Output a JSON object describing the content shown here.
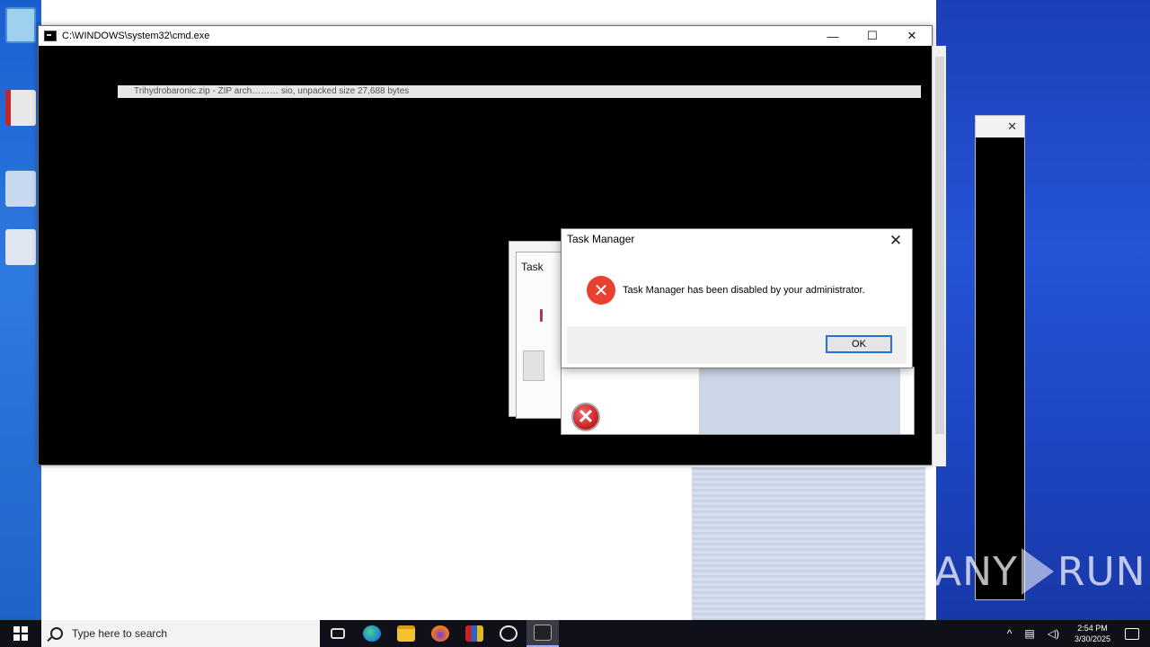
{
  "cmd_window": {
    "title": "C:\\WINDOWS\\system32\\cmd.exe",
    "minimize": "—",
    "maximize": "☐",
    "close": "✕",
    "output_line": "Trihydrobaronic.zip - ZIP arch……… sio, unpacked size 27,688 bytes"
  },
  "side_window": {
    "close": "✕"
  },
  "ghost_dialog": {
    "title": "Task"
  },
  "dialog": {
    "title": "Task Manager",
    "close": "✕",
    "icon": "error-icon",
    "message": "Task Manager has been disabled by your administrator.",
    "ok_label": "OK"
  },
  "watermark": {
    "left": "ANY",
    "right": "RUN"
  },
  "taskbar": {
    "search_placeholder": "Type here to search",
    "apps": [
      "task-view",
      "edge",
      "file-explorer",
      "firefox",
      "winrar",
      "app",
      "cmd"
    ],
    "tray": [
      "^",
      "network",
      "volume"
    ],
    "time": "2:54 PM",
    "date": "3/30/2025"
  },
  "colors": {
    "desktop_blue": "#2554d6",
    "error_red": "#e8412f",
    "ok_border": "#2a6fd6"
  }
}
